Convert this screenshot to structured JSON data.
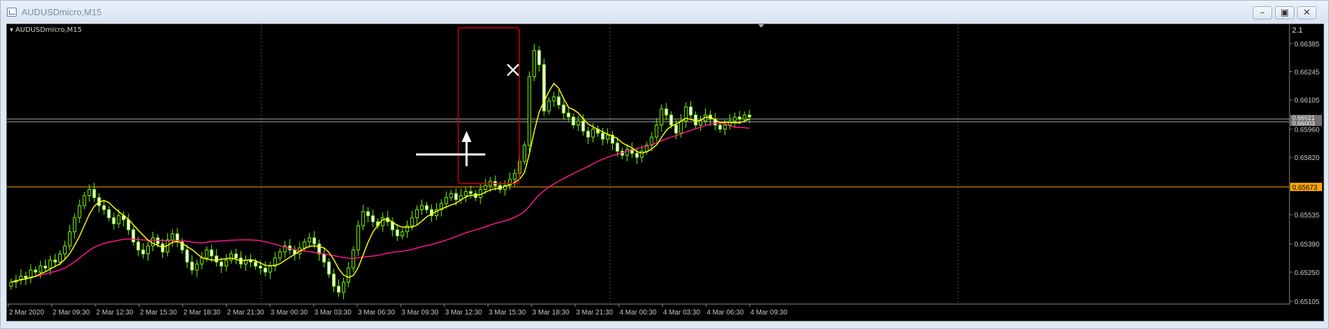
{
  "window": {
    "title": "AUDUSDmicro,M15",
    "min_icon": "minimize-icon",
    "max_icon": "maximize-icon",
    "close_icon": "close-icon"
  },
  "chart": {
    "symbol_label": "AUDUSDmicro,M15",
    "scale_label": "2.1",
    "background": "#000000",
    "up_color": "#7CFC00",
    "ma_fast_color": "#FFFF00",
    "ma_slow_color": "#FF1493",
    "level_line_color": "#FFA500",
    "highlight_box_color": "#CC0000",
    "price_ticks": [
      "0.66385",
      "0.66245",
      "0.66105",
      "0.65960",
      "0.65820",
      "0.65535",
      "0.65390",
      "0.65250",
      "0.65105"
    ],
    "level_price": "0.65673",
    "current_price_labels": [
      "0.66021",
      "0.66003"
    ],
    "time_ticks": [
      "2 Mar 2020",
      "2 Mar 09:30",
      "2 Mar 12:30",
      "2 Mar 15:30",
      "2 Mar 18:30",
      "2 Mar 21:30",
      "3 Mar 00:30",
      "3 Mar 03:30",
      "3 Mar 06:30",
      "3 Mar 09:30",
      "3 Mar 12:30",
      "3 Mar 15:30",
      "3 Mar 18:30",
      "3 Mar 21:30",
      "4 Mar 00:30",
      "4 Mar 03:30",
      "4 Mar 06:30",
      "4 Mar 09:30"
    ]
  },
  "chart_data": {
    "type": "candlestick",
    "candle_closes": [
      0.652,
      0.6521,
      0.6523,
      0.6522,
      0.6526,
      0.6525,
      0.6528,
      0.6527,
      0.6531,
      0.653,
      0.6534,
      0.6538,
      0.6545,
      0.6552,
      0.6558,
      0.6563,
      0.6566,
      0.6562,
      0.6558,
      0.6556,
      0.6552,
      0.6549,
      0.6553,
      0.6551,
      0.6546,
      0.654,
      0.6536,
      0.6534,
      0.6538,
      0.6542,
      0.6539,
      0.6535,
      0.6541,
      0.6544,
      0.654,
      0.6536,
      0.653,
      0.6526,
      0.6529,
      0.6532,
      0.6536,
      0.6533,
      0.653,
      0.6528,
      0.6531,
      0.6534,
      0.6532,
      0.6529,
      0.6531,
      0.653,
      0.6528,
      0.6527,
      0.6525,
      0.6528,
      0.6532,
      0.6535,
      0.6538,
      0.6536,
      0.6534,
      0.6537,
      0.654,
      0.6542,
      0.6539,
      0.6534,
      0.653,
      0.6524,
      0.6518,
      0.6515,
      0.652,
      0.6527,
      0.6536,
      0.6548,
      0.6555,
      0.6553,
      0.655,
      0.6548,
      0.6552,
      0.655,
      0.6546,
      0.6543,
      0.6545,
      0.6548,
      0.6552,
      0.6556,
      0.6558,
      0.6556,
      0.6553,
      0.6556,
      0.6559,
      0.6562,
      0.6564,
      0.6561,
      0.6563,
      0.6565,
      0.6564,
      0.6562,
      0.6566,
      0.6568,
      0.657,
      0.6568,
      0.6566,
      0.6568,
      0.6571,
      0.6574,
      0.658,
      0.6588,
      0.6622,
      0.6635,
      0.6628,
      0.6605,
      0.661,
      0.6612,
      0.6608,
      0.6604,
      0.6602,
      0.6598,
      0.66,
      0.6595,
      0.6592,
      0.6596,
      0.6594,
      0.6591,
      0.6593,
      0.6589,
      0.6585,
      0.6583,
      0.6586,
      0.6584,
      0.6582,
      0.6585,
      0.6588,
      0.6592,
      0.6598,
      0.6606,
      0.6603,
      0.6598,
      0.6594,
      0.66,
      0.6607,
      0.6603,
      0.6598,
      0.66,
      0.6603,
      0.6601,
      0.6598,
      0.6596,
      0.6598,
      0.66,
      0.6602,
      0.6601,
      0.6603,
      0.6602
    ],
    "ylim": [
      0.65105,
      0.6646
    ],
    "level_price": 0.65673,
    "current_price": 0.66003,
    "arrow_direction": "up",
    "cross_marker": true,
    "highlight_box": true,
    "grid": "vertical-dotted"
  }
}
